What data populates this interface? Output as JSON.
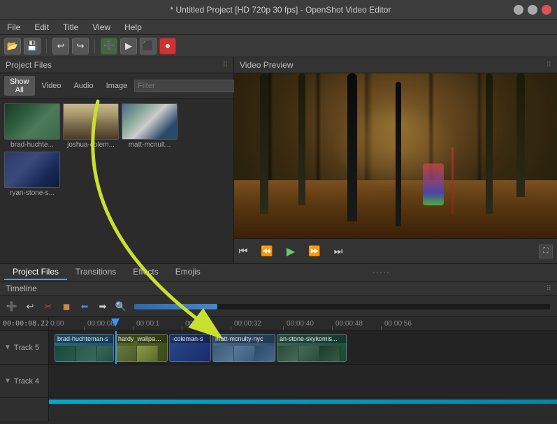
{
  "window": {
    "title": "* Untitled Project [HD 720p 30 fps] - OpenShot Video Editor",
    "min_btn": "−",
    "max_btn": "□",
    "close_btn": "✕"
  },
  "menu": {
    "items": [
      "File",
      "Edit",
      "Title",
      "View",
      "Help"
    ]
  },
  "toolbar": {
    "buttons": [
      "📁",
      "💾",
      "↩",
      "↪",
      "➕",
      "▶",
      "⬛",
      "⏺"
    ]
  },
  "left_panel": {
    "title": "Project Files",
    "filter_tabs": [
      "Show All",
      "Video",
      "Audio",
      "Image"
    ],
    "filter_placeholder": "Filter",
    "files": [
      {
        "id": "brad",
        "label": "brad-huchte..."
      },
      {
        "id": "joshua",
        "label": "joshua-colem..."
      },
      {
        "id": "matt",
        "label": "matt-mcnult..."
      },
      {
        "id": "ryan",
        "label": "ryan-stone-s..."
      }
    ]
  },
  "right_panel": {
    "title": "Video Preview"
  },
  "preview_controls": {
    "skip_start": "⏮",
    "rewind": "⏪",
    "play": "▶",
    "fast_forward": "⏩",
    "skip_end": "⏭"
  },
  "bottom_tabs": {
    "tabs": [
      "Project Files",
      "Transitions",
      "Effects",
      "Emojis"
    ],
    "active": "Project Files"
  },
  "timeline": {
    "title": "Timeline",
    "timecode": "00:00:08.22",
    "ruler_marks": [
      "0:00",
      "00:00:08",
      "00:00:1",
      "00:00:24",
      "00:00:32",
      "00:00:40",
      "00:00:48",
      "00:00:56"
    ],
    "tracks": [
      {
        "label": "Track 5",
        "clips": [
          {
            "id": "brad",
            "label": "brad-huchteman-s",
            "class": "clip-brad"
          },
          {
            "id": "wallpaper",
            "label": "hardy_wallpaper_",
            "class": "clip-wallpaper"
          },
          {
            "id": "coleman",
            "label": "-coleman-s",
            "class": "clip-coleman"
          },
          {
            "id": "matt",
            "label": "matt-mcnulty-nyc",
            "class": "clip-matt"
          },
          {
            "id": "ryan",
            "label": "an-stone-skykomis...",
            "class": "clip-ryan"
          }
        ]
      },
      {
        "label": "Track 4",
        "clips": []
      }
    ]
  }
}
